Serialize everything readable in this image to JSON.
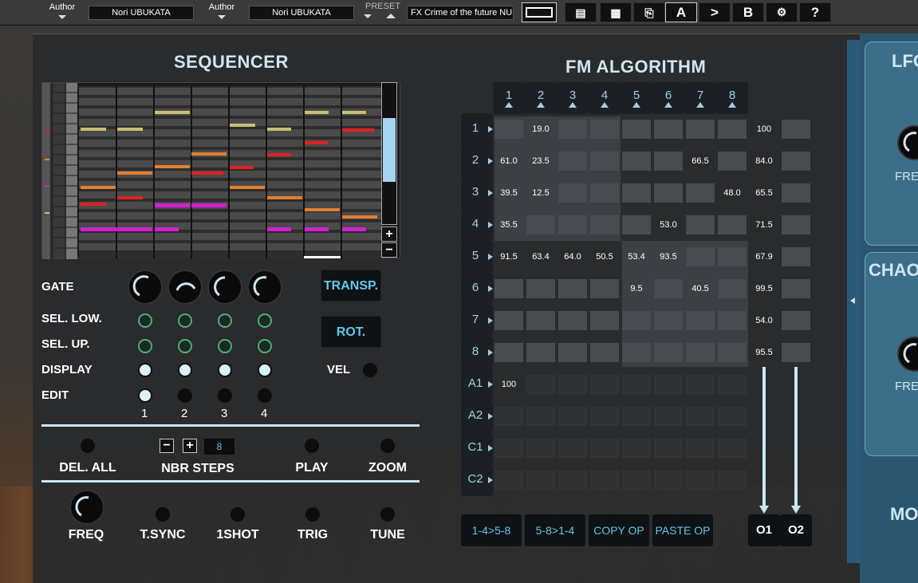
{
  "toolbar": {
    "author_label_1": "Author",
    "author_value_1": "Nori UBUKATA",
    "author_label_2": "Author",
    "author_value_2": "Nori UBUKATA",
    "preset_label": "PRESET",
    "preset_name": "FX Crime of the future NU",
    "a_label": "A",
    "compare_label": ">",
    "b_label": "B",
    "help_label": "?"
  },
  "sequencer": {
    "title": "SEQUENCER",
    "zoom_plus": "+",
    "zoom_minus": "−",
    "gate_label": "GATE",
    "sel_low_label": "SEL. LOW.",
    "sel_up_label": "SEL. UP.",
    "display_label": "DISPLAY",
    "edit_label": "EDIT",
    "transp_label": "TRANSP.",
    "rot_label": "ROT.",
    "vel_label": "VEL",
    "columns": [
      "1",
      "2",
      "3",
      "4"
    ],
    "del_all_label": "DEL. ALL",
    "nbr_steps_label": "NBR STEPS",
    "nbr_steps_minus": "−",
    "nbr_steps_plus": "+",
    "nbr_steps_value": "8",
    "play_label": "PLAY",
    "zoom_label": "ZOOM",
    "freq_label": "FREQ",
    "tsync_label": "T.SYNC",
    "oneshot_label": "1SHOT",
    "trig_label": "TRIG",
    "tune_label": "TUNE"
  },
  "fm": {
    "title": "FM ALGORITHM",
    "col_headers": [
      "1",
      "2",
      "3",
      "4",
      "5",
      "6",
      "7",
      "8"
    ],
    "row_headers": [
      "1",
      "2",
      "3",
      "4",
      "5",
      "6",
      "7",
      "8",
      "A1",
      "A2",
      "C1",
      "C2"
    ],
    "matrix": [
      [
        "",
        "19.0",
        "",
        "",
        "",
        "",
        "",
        ""
      ],
      [
        "61.0",
        "23.5",
        "",
        "",
        "",
        "",
        "66.5",
        ""
      ],
      [
        "39.5",
        "12.5",
        "",
        "",
        "",
        "",
        "",
        "48.0"
      ],
      [
        "35.5",
        "",
        "",
        "",
        "",
        "53.0",
        "",
        ""
      ],
      [
        "91.5",
        "63.4",
        "64.0",
        "50.5",
        "53.4",
        "93.5",
        "",
        ""
      ],
      [
        "",
        "",
        "",
        "",
        "9.5",
        "",
        "40.5",
        ""
      ],
      [
        "",
        "",
        "",
        "",
        "",
        "",
        "",
        ""
      ],
      [
        "",
        "",
        "",
        "",
        "",
        "",
        "",
        ""
      ],
      [
        "100",
        "",
        "",
        "",
        "",
        "",
        "",
        ""
      ],
      [
        "",
        "",
        "",
        "",
        "",
        "",
        "",
        ""
      ],
      [
        "",
        "",
        "",
        "",
        "",
        "",
        "",
        ""
      ],
      [
        "",
        "",
        "",
        "",
        "",
        "",
        "",
        ""
      ]
    ],
    "out1": [
      "100",
      "84.0",
      "65.5",
      "71.5",
      "67.9",
      "99.5",
      "54.0",
      "95.5"
    ],
    "btn_14_58": "1-4>5-8",
    "btn_58_14": "5-8>1-4",
    "copy_op": "COPY OP",
    "paste_op": "PASTE OP",
    "o1": "O1",
    "o2": "O2"
  },
  "right": {
    "lfo_title": "LFO",
    "lfo_freq": "FREQ",
    "chaos_title": "CHAO",
    "chaos_freq": "FREQ",
    "mod_title": "MO"
  }
}
